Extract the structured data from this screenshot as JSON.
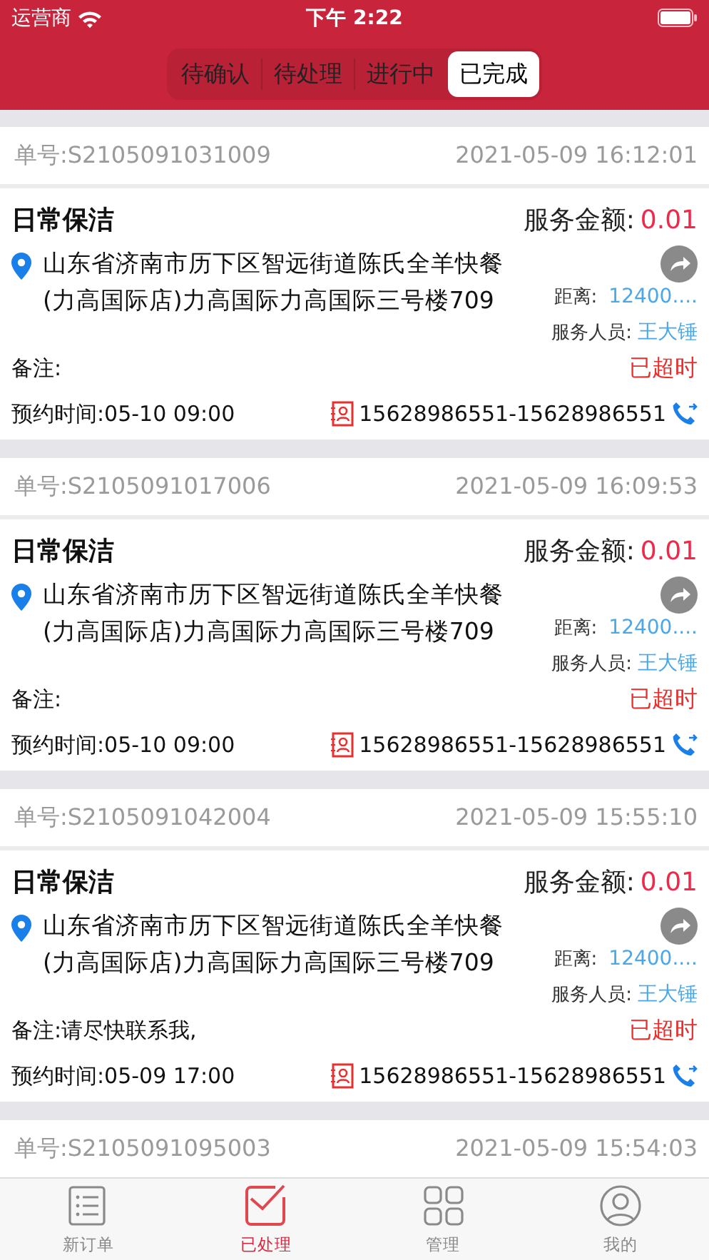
{
  "status_bar": {
    "carrier": "运营商",
    "time": "下午 2:22"
  },
  "segments": [
    {
      "label": "待确认",
      "selected": false
    },
    {
      "label": "待处理",
      "selected": false
    },
    {
      "label": "进行中",
      "selected": false
    },
    {
      "label": "已完成",
      "selected": true
    }
  ],
  "orders": [
    {
      "number": "单号:S2105091031009",
      "created": "2021-05-09 16:12:01",
      "service": "日常保洁",
      "amount_label": "服务金额:",
      "amount": "0.01",
      "address": "山东省济南市历下区智远街道陈氏全羊快餐(力高国际店)力高国际力高国际三号楼709",
      "distance_label": "距离:",
      "distance": "12400....",
      "staff_label": "服务人员:",
      "staff": "王大锤",
      "note": "备注:",
      "status": "已超时",
      "appointment": "预约时间:05-10 09:00",
      "phone": "15628986551-15628986551"
    },
    {
      "number": "单号:S2105091017006",
      "created": "2021-05-09 16:09:53",
      "service": "日常保洁",
      "amount_label": "服务金额:",
      "amount": "0.01",
      "address": "山东省济南市历下区智远街道陈氏全羊快餐(力高国际店)力高国际力高国际三号楼709",
      "distance_label": "距离:",
      "distance": "12400....",
      "staff_label": "服务人员:",
      "staff": "王大锤",
      "note": "备注:",
      "status": "已超时",
      "appointment": "预约时间:05-10 09:00",
      "phone": "15628986551-15628986551"
    },
    {
      "number": "单号:S2105091042004",
      "created": "2021-05-09 15:55:10",
      "service": "日常保洁",
      "amount_label": "服务金额:",
      "amount": "0.01",
      "address": "山东省济南市历下区智远街道陈氏全羊快餐(力高国际店)力高国际力高国际三号楼709",
      "distance_label": "距离:",
      "distance": "12400....",
      "staff_label": "服务人员:",
      "staff": "王大锤",
      "note": "备注:请尽快联系我,",
      "status": "已超时",
      "appointment": "预约时间:05-09 17:00",
      "phone": "15628986551-15628986551"
    },
    {
      "number": "单号:S2105091095003",
      "created": "2021-05-09 15:54:03"
    }
  ],
  "tab_bar": [
    {
      "label": "新订单",
      "kind": "list",
      "selected": false
    },
    {
      "label": "已处理",
      "kind": "done",
      "selected": true
    },
    {
      "label": "管理",
      "kind": "grid",
      "selected": false
    },
    {
      "label": "我的",
      "kind": "user",
      "selected": false
    }
  ]
}
